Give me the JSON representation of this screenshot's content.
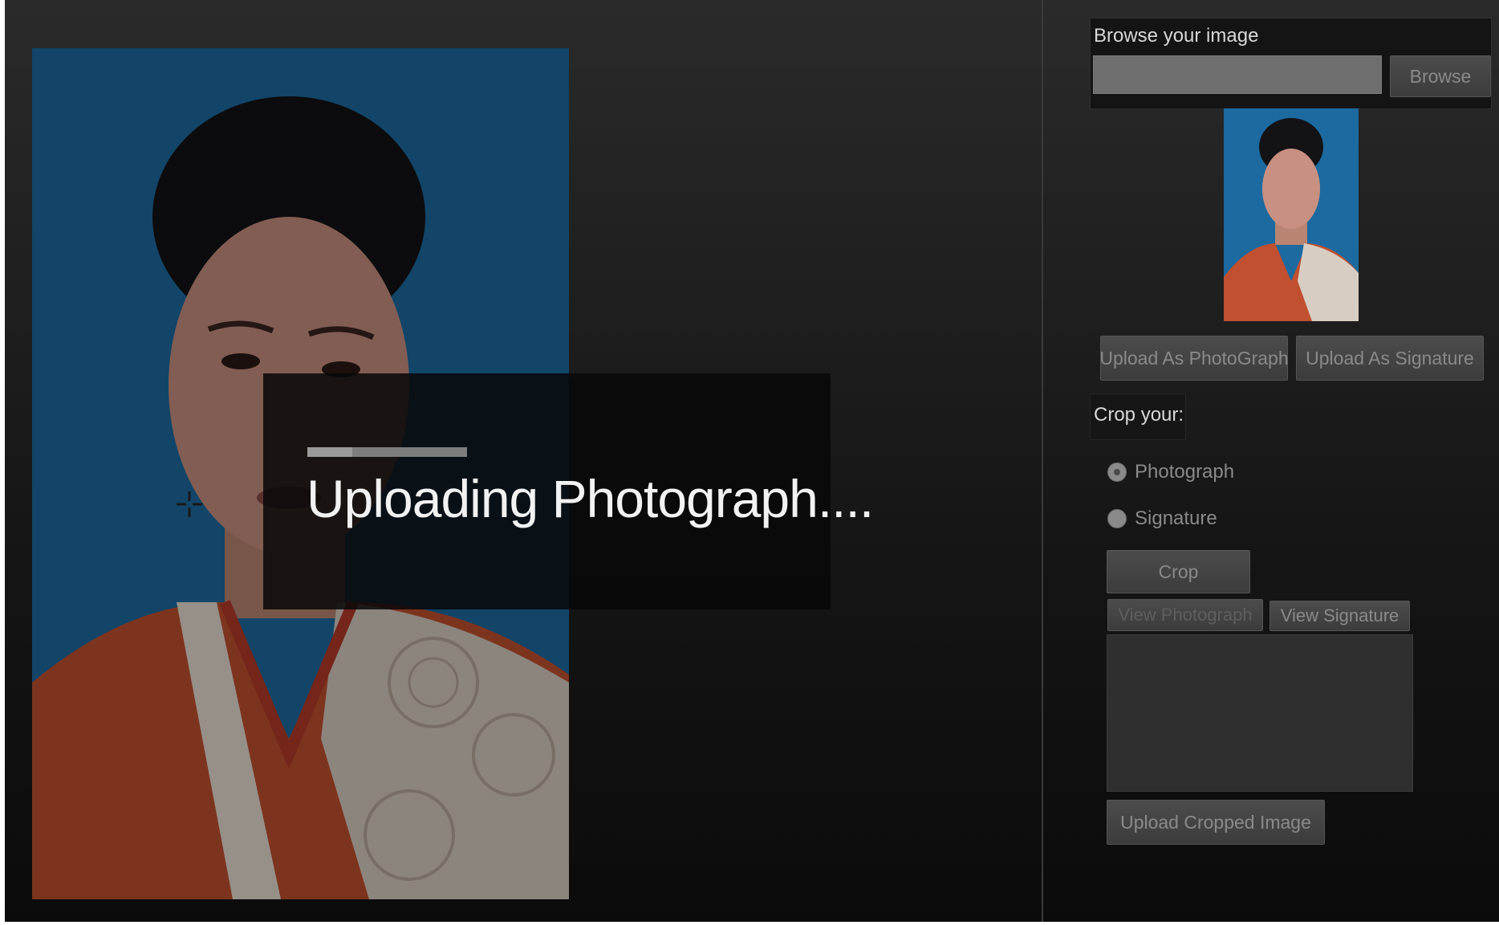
{
  "overlay": {
    "message": "Uploading Photograph....",
    "progress": 0.28
  },
  "browse": {
    "title": "Browse your image",
    "input_value": "",
    "button_label": "Browse"
  },
  "upload_buttons": {
    "photo_label": "Upload As PhotoGraph",
    "signature_label": "Upload As Signature"
  },
  "crop": {
    "title": "Crop your:",
    "options": [
      {
        "label": "Photograph",
        "selected": true
      },
      {
        "label": "Signature",
        "selected": false
      }
    ],
    "crop_button": "Crop",
    "view_photograph": "View Photograph",
    "view_signature": "View Signature",
    "upload_cropped": "Upload Cropped Image"
  },
  "colors": {
    "photo_background": "#1c6aa0",
    "dress": "#c0502f"
  }
}
